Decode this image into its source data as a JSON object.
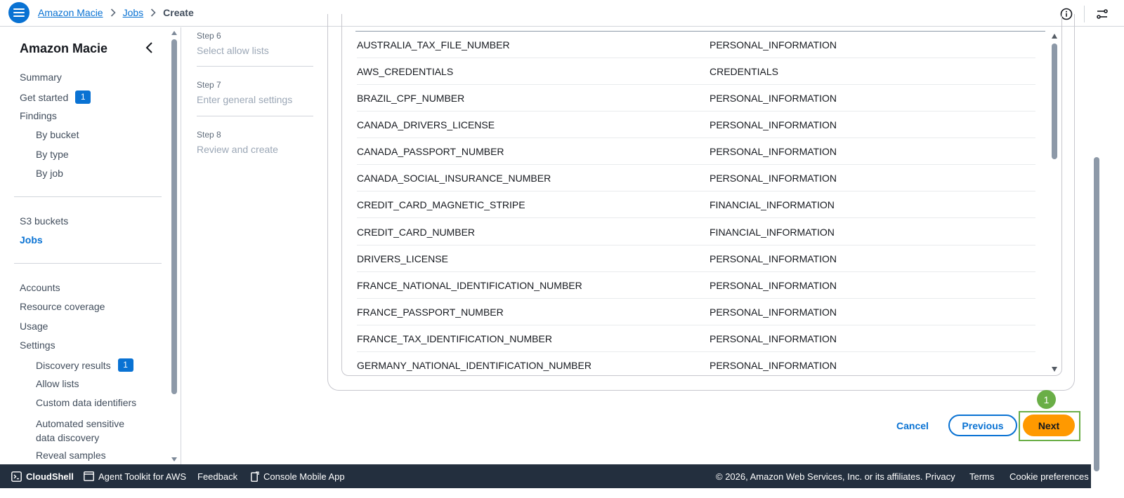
{
  "header": {
    "breadcrumb": [
      {
        "label": "Amazon Macie",
        "link": true
      },
      {
        "label": "Jobs",
        "link": true
      },
      {
        "label": "Create",
        "link": false
      }
    ]
  },
  "sidebar": {
    "title": "Amazon Macie",
    "items": [
      {
        "label": "Summary"
      },
      {
        "label": "Get started",
        "badge": "1"
      },
      {
        "label": "Findings"
      },
      {
        "label": "By bucket"
      },
      {
        "label": "By type"
      },
      {
        "label": "By job"
      },
      {
        "label": "S3 buckets"
      },
      {
        "label": "Jobs",
        "active": true
      },
      {
        "label": "Accounts"
      },
      {
        "label": "Resource coverage"
      },
      {
        "label": "Usage"
      },
      {
        "label": "Settings"
      },
      {
        "label": "Discovery results",
        "badge": "1"
      },
      {
        "label": "Allow lists"
      },
      {
        "label": "Custom data identifiers"
      },
      {
        "label": "Automated sensitive"
      },
      {
        "label": "data discovery"
      },
      {
        "label": "Reveal samples"
      }
    ]
  },
  "steps": [
    {
      "number": "Step 6",
      "name": "Select allow lists"
    },
    {
      "number": "Step 7",
      "name": "Enter general settings"
    },
    {
      "number": "Step 8",
      "name": "Review and create"
    }
  ],
  "table": {
    "rows": [
      [
        "AUSTRALIA_TAX_FILE_NUMBER",
        "PERSONAL_INFORMATION"
      ],
      [
        "AWS_CREDENTIALS",
        "CREDENTIALS"
      ],
      [
        "BRAZIL_CPF_NUMBER",
        "PERSONAL_INFORMATION"
      ],
      [
        "CANADA_DRIVERS_LICENSE",
        "PERSONAL_INFORMATION"
      ],
      [
        "CANADA_PASSPORT_NUMBER",
        "PERSONAL_INFORMATION"
      ],
      [
        "CANADA_SOCIAL_INSURANCE_NUMBER",
        "PERSONAL_INFORMATION"
      ],
      [
        "CREDIT_CARD_MAGNETIC_STRIPE",
        "FINANCIAL_INFORMATION"
      ],
      [
        "CREDIT_CARD_NUMBER",
        "FINANCIAL_INFORMATION"
      ],
      [
        "DRIVERS_LICENSE",
        "PERSONAL_INFORMATION"
      ],
      [
        "FRANCE_NATIONAL_IDENTIFICATION_NUMBER",
        "PERSONAL_INFORMATION"
      ],
      [
        "FRANCE_PASSPORT_NUMBER",
        "PERSONAL_INFORMATION"
      ],
      [
        "FRANCE_TAX_IDENTIFICATION_NUMBER",
        "PERSONAL_INFORMATION"
      ],
      [
        "GERMANY_NATIONAL_IDENTIFICATION_NUMBER",
        "PERSONAL_INFORMATION"
      ]
    ]
  },
  "actions": {
    "cancel": "Cancel",
    "previous": "Previous",
    "next": "Next",
    "marker": "1"
  },
  "footer": {
    "cloudshell": "CloudShell",
    "agent_toolkit": "Agent Toolkit for AWS",
    "feedback": "Feedback",
    "mobile_app": "Console Mobile App",
    "copyright": "© 2026, Amazon Web Services, Inc. or its affiliates.",
    "privacy": "Privacy",
    "terms": "Terms",
    "cookies": "Cookie preferences"
  },
  "colors": {
    "accent": "#0972d3",
    "primary_button": "#ff9900",
    "highlight": "#6aae47",
    "footer_bg": "#232f3e"
  }
}
